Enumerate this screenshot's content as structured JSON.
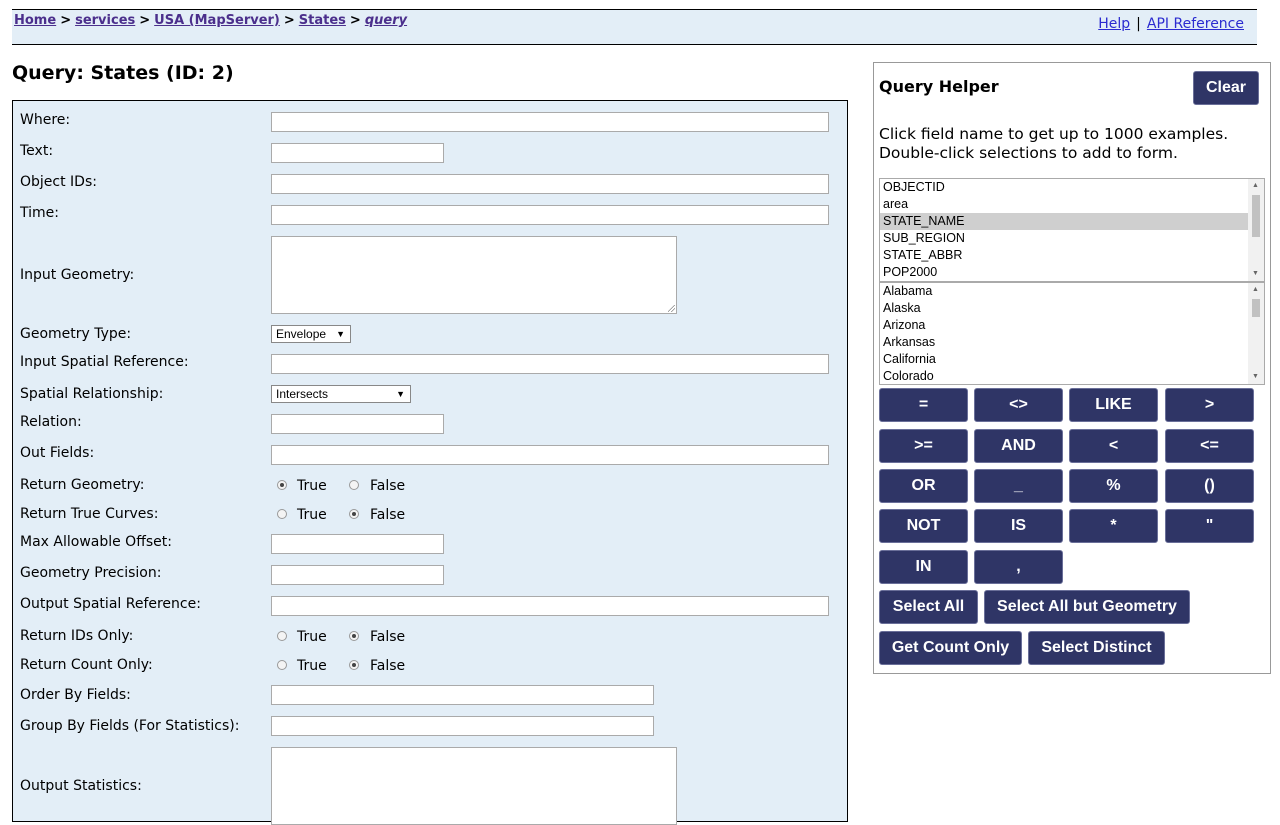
{
  "breadcrumb": {
    "home": "Home",
    "services": "services",
    "service": "USA (MapServer)",
    "layer": "States",
    "current": "query",
    "separator": ">"
  },
  "header_links": {
    "help": "Help",
    "separator": "|",
    "api": "API Reference"
  },
  "page_title": "Query: States (ID: 2)",
  "form": {
    "where": "Where:",
    "text": "Text:",
    "object_ids": "Object IDs:",
    "time": "Time:",
    "input_geometry": "Input Geometry:",
    "geometry_type": "Geometry Type:",
    "geometry_type_value": "Envelope",
    "input_sr": "Input Spatial Reference:",
    "spatial_rel": "Spatial Relationship:",
    "spatial_rel_value": "Intersects",
    "relation": "Relation:",
    "out_fields": "Out Fields:",
    "return_geometry": "Return Geometry:",
    "return_true_curves": "Return True Curves:",
    "max_offset": "Max Allowable Offset:",
    "geometry_precision": "Geometry Precision:",
    "output_sr": "Output Spatial Reference:",
    "return_ids_only": "Return IDs Only:",
    "return_count_only": "Return Count Only:",
    "order_by": "Order By Fields:",
    "group_by": "Group By Fields (For Statistics):",
    "output_statistics": "Output Statistics:",
    "true_label": "True",
    "false_label": "False"
  },
  "helper": {
    "title": "Query Helper",
    "clear": "Clear",
    "desc_line1": "Click field name to get up to 1000 examples.",
    "desc_line2": "Double-click selections to add to form.",
    "fields": [
      "OBJECTID",
      "area",
      "STATE_NAME",
      "SUB_REGION",
      "STATE_ABBR",
      "POP2000"
    ],
    "selected_field": "STATE_NAME",
    "values": [
      "Alabama",
      "Alaska",
      "Arizona",
      "Arkansas",
      "California",
      "Colorado"
    ],
    "operators": [
      "=",
      "<>",
      "LIKE",
      ">",
      ">=",
      "AND",
      "<",
      "<=",
      "OR",
      "_",
      "%",
      "()",
      "NOT",
      "IS",
      "*",
      "\"",
      "IN",
      ","
    ],
    "select_all": "Select All",
    "select_all_but_geometry": "Select All but Geometry",
    "get_count_only": "Get Count Only",
    "select_distinct": "Select Distinct"
  }
}
